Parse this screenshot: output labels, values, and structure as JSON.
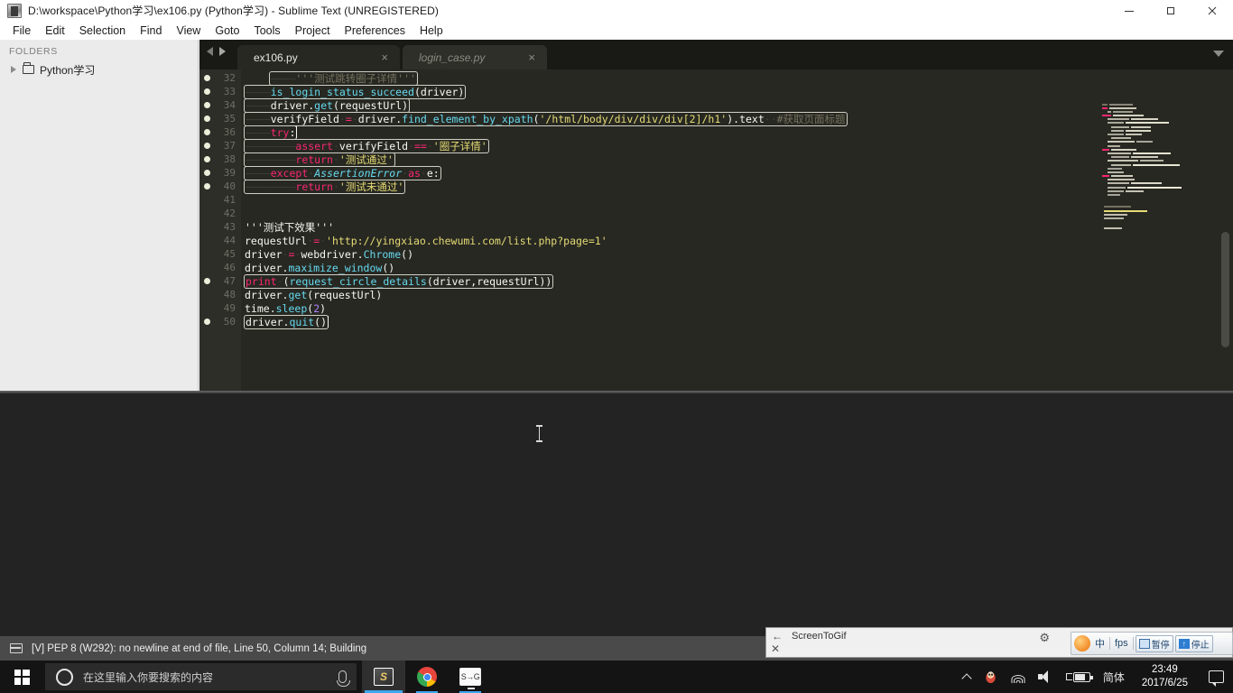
{
  "window": {
    "title": "D:\\workspace\\Python学习\\ex106.py (Python学习) - Sublime Text (UNREGISTERED)",
    "minimize": "—",
    "maximize": "❐",
    "close": "✕"
  },
  "menu": {
    "items": [
      "File",
      "Edit",
      "Selection",
      "Find",
      "View",
      "Goto",
      "Tools",
      "Project",
      "Preferences",
      "Help"
    ]
  },
  "sidebar": {
    "header": "FOLDERS",
    "folders": [
      {
        "label": "Python学习"
      }
    ]
  },
  "tabs": {
    "items": [
      {
        "label": "ex106.py",
        "close": "×",
        "active": true
      },
      {
        "label": "login_case.py",
        "close": "×",
        "active": false
      }
    ]
  },
  "editor": {
    "first_line": 32,
    "lines": [
      {
        "num": "32",
        "dot": true,
        "text": "    '''测试跳转圈子详情'''"
      },
      {
        "num": "33",
        "dot": true,
        "text": "    is_login_status_succeed(driver)"
      },
      {
        "num": "34",
        "dot": true,
        "text": "    driver.get(requestUrl)"
      },
      {
        "num": "35",
        "dot": true,
        "text": "    verifyField = driver.find_element_by_xpath('/html/body/div/div/div[2]/h1').text  #获取页面标题"
      },
      {
        "num": "36",
        "dot": true,
        "text": "    try:"
      },
      {
        "num": "37",
        "dot": true,
        "text": "        assert verifyField == '圈子详情'"
      },
      {
        "num": "38",
        "dot": true,
        "text": "            return '测试通过'"
      },
      {
        "num": "39",
        "dot": true,
        "text": "    except AssertionError as e:"
      },
      {
        "num": "40",
        "dot": true,
        "text": "            return '测试未通过'"
      },
      {
        "num": "41",
        "dot": false,
        "text": ""
      },
      {
        "num": "42",
        "dot": false,
        "text": ""
      },
      {
        "num": "43",
        "dot": false,
        "text": "'''测试下效果'''"
      },
      {
        "num": "44",
        "dot": false,
        "text": "requestUrl = 'http://yingxiao.chewumi.com/list.php?page=1'"
      },
      {
        "num": "45",
        "dot": false,
        "text": "driver = webdriver.Chrome()"
      },
      {
        "num": "46",
        "dot": false,
        "text": "driver.maximize_window()"
      },
      {
        "num": "47",
        "dot": true,
        "text": "print (request_circle_details(driver,requestUrl))"
      },
      {
        "num": "48",
        "dot": false,
        "text": "driver.get(requestUrl)"
      },
      {
        "num": "49",
        "dot": false,
        "text": "time.sleep(2)"
      },
      {
        "num": "50",
        "dot": true,
        "text": "driver.quit()"
      }
    ]
  },
  "status": {
    "text": "[V] PEP 8 (W292): no newline at end of file, Line 50, Column 14; Building"
  },
  "screentogif": {
    "title": "ScreenToGif",
    "back": "←",
    "close": "✕",
    "gear": "⚙"
  },
  "ime": {
    "mode": "中",
    "fps_label": "fps",
    "pause_label": "暂停",
    "stop_label": "停止",
    "arrow": "↑"
  },
  "taskbar": {
    "search_placeholder": "在这里输入你要搜索的内容",
    "apps": [
      {
        "name": "sublime-text",
        "glyph": "S"
      },
      {
        "name": "google-chrome",
        "glyph": ""
      },
      {
        "name": "screentogif",
        "glyph": "S→G"
      }
    ],
    "tray": {
      "overflow": "∧",
      "language": "简体",
      "time": "23:49",
      "date": "2017/6/25"
    }
  }
}
